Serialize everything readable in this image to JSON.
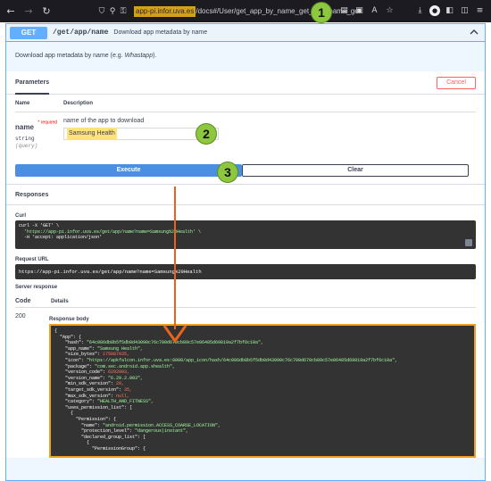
{
  "browser": {
    "url_host": "app-pi.infor.uva.es",
    "url_path": "/docs#/User/get_app_by_name_get_app_name_get",
    "icons": [
      "back-icon",
      "forward-icon",
      "reload-icon",
      "shield-icon",
      "tracking-icon",
      "lock-icon",
      "reader-icon",
      "screenshot-icon",
      "translate-icon",
      "bookmark-icon",
      "download-icon",
      "account-icon",
      "extension-icon",
      "pocket-icon",
      "menu-icon"
    ]
  },
  "callouts": {
    "one": "1",
    "two": "2",
    "three": "3"
  },
  "operation": {
    "method": "GET",
    "path": "/get/app/name",
    "summary": "Download app metadata by name",
    "description_prefix": "Download app metadata by name (e.g. ",
    "description_example": "Whastapp",
    "description_suffix": ")."
  },
  "parameters": {
    "title": "Parameters",
    "cancel_label": "Cancel",
    "col_name": "Name",
    "col_description": "Description",
    "param": {
      "name": "name",
      "required": "* required",
      "type": "string",
      "in": "(query)",
      "description": "name of the app to download",
      "value": "Samsung Health"
    }
  },
  "actions": {
    "execute": "Execute",
    "clear": "Clear"
  },
  "responses": {
    "title": "Responses",
    "curl_label": "Curl",
    "curl_line1": "curl -X 'GET' \\",
    "curl_line2": "  'https://app-pi.infor.uva.es/get/app/name?name=Samsung%20Health' \\",
    "curl_line3": "  -H 'accept: application/json'",
    "request_url_label": "Request URL",
    "request_url": "https://app-pi.infor.uva.es/get/app/name?name=Samsung%20Health",
    "server_response_label": "Server response",
    "col_code": "Code",
    "col_details": "Details",
    "code": "200",
    "body_label": "Response body",
    "body_lines": [
      "{",
      "  \"App\": {",
      "    \"hash\": \"64c086db8b5f5db0d43090c76c700d670cb89c57e06485d69819a2f7bf6c10a\",",
      "    \"app_name\": \"Samsung Health\",",
      "    \"size_bytes\": 175087035,",
      "    \"icon\": \"https://apkfalcon.infor.uva.es:8000/app_icon/hash/64c086db8b5f5db0d43090c76c700d670cb89c57e06485d69819a2f7bf6c10a\",",
      "    \"package\": \"com.sec.android.app.shealth\",",
      "    \"version_code\": 6292003,",
      "    \"version_name\": \"6.29.2.003\",",
      "    \"min_sdk_version\": 29,",
      "    \"target_sdk_version\": 35,",
      "    \"max_sdk_version\": null,",
      "    \"category\": \"HEALTH_AND_FITNESS\",",
      "    \"uses_permission_list\": [",
      "      {",
      "        \"Permission\": {",
      "          \"name\": \"android.permission.ACCESS_COARSE_LOCATION\",",
      "          \"protection_level\": \"dangerous|instant\",",
      "          \"declared_group_list\": [",
      "            {",
      "              \"PermissionGroup\": {"
    ]
  }
}
